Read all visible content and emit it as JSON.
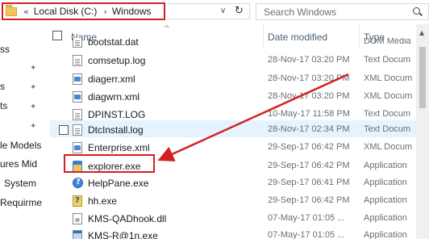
{
  "address_bar": {
    "path": [
      "Local Disk (C:)",
      "Windows"
    ],
    "overflow_glyph": "«",
    "separator": "›",
    "dropdown_glyph": "∨",
    "refresh_glyph": "↻"
  },
  "search": {
    "placeholder": "Search Windows"
  },
  "nav_pane": {
    "items": [
      {
        "label": "ss",
        "pinned": false
      },
      {
        "label": "",
        "pinned": true
      },
      {
        "label": "ts",
        "pinned": true
      },
      {
        "label": "s",
        "pinned": true
      },
      {
        "label": "",
        "pinned": true
      },
      {
        "label": "le Models",
        "pinned": false
      },
      {
        "label": "ures Mid",
        "pinned": false
      },
      {
        "label": "System",
        "pinned": false
      },
      {
        "label": "Requirme",
        "pinned": false
      }
    ]
  },
  "columns": {
    "name": "Name",
    "date_modified": "Date modified",
    "type": "Type",
    "sort_glyph": "^"
  },
  "files": [
    {
      "name": "bootstat.dat",
      "date": "",
      "type": "DOM Media",
      "icon": "document-icon"
    },
    {
      "name": "comsetup.log",
      "date": "28-Nov-17 03:20 PM",
      "type": "Text Docum",
      "icon": "document-icon"
    },
    {
      "name": "diagerr.xml",
      "date": "28-Nov-17 03:20 PM",
      "type": "XML Docum",
      "icon": "xml-icon"
    },
    {
      "name": "diagwrn.xml",
      "date": "28-Nov-17 03:20 PM",
      "type": "XML Docum",
      "icon": "xml-icon"
    },
    {
      "name": "DPINST.LOG",
      "date": "10-May-17 11:58 PM",
      "type": "Text Docum",
      "icon": "document-icon"
    },
    {
      "name": "DtcInstall.log",
      "date": "28-Nov-17 02:34 PM",
      "type": "Text Docum",
      "icon": "document-icon",
      "selected": true
    },
    {
      "name": "Enterprise.xml",
      "date": "29-Sep-17 06:42 PM",
      "type": "XML Docum",
      "icon": "xml-icon"
    },
    {
      "name": "explorer.exe",
      "date": "29-Sep-17 06:42 PM",
      "type": "Application",
      "icon": "explorer-icon",
      "highlighted": true
    },
    {
      "name": "HelpPane.exe",
      "date": "29-Sep-17 06:41 PM",
      "type": "Application",
      "icon": "help-icon"
    },
    {
      "name": "hh.exe",
      "date": "29-Sep-17 06:42 PM",
      "type": "Application",
      "icon": "hh-icon"
    },
    {
      "name": "KMS-QADhook.dll",
      "date": "07-May-17 01:05 ...",
      "type": "Application",
      "icon": "dll-icon"
    },
    {
      "name": "KMS-R@1n.exe",
      "date": "07-May-17 01:05 ...",
      "type": "Application",
      "icon": "exe-icon"
    }
  ],
  "annotation": {
    "color": "#d42020"
  }
}
